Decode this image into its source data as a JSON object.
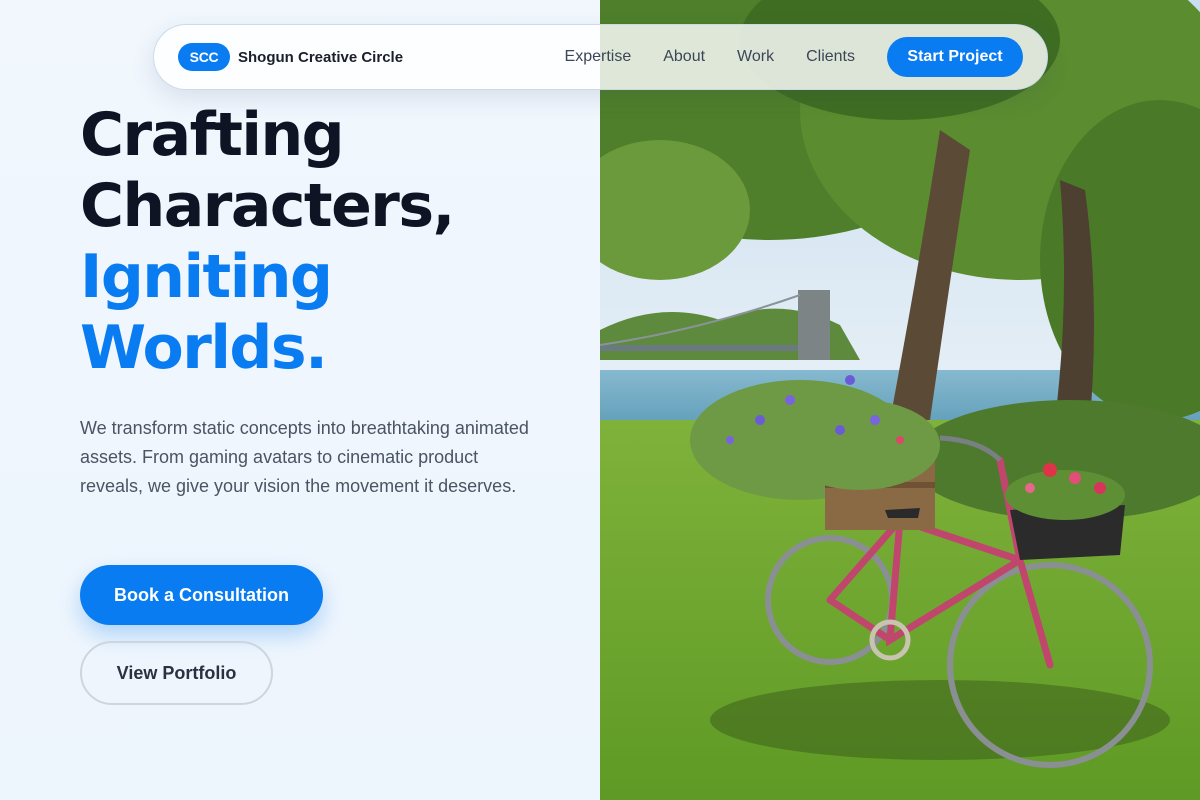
{
  "brand": {
    "badge": "SCC",
    "name": "Shogun Creative Circle"
  },
  "nav": {
    "links": [
      "Expertise",
      "About",
      "Work",
      "Clients"
    ],
    "cta": "Start Project"
  },
  "hero": {
    "line1": "Crafting",
    "line2": "Characters,",
    "line3": "Igniting",
    "line4": "Worlds.",
    "description": "We transform static concepts into breathtaking animated assets. From gaming avatars to cinematic product reveals, we give your vision the movement it deserves.",
    "primary_button": "Book a Consultation",
    "secondary_button": "View Portfolio"
  },
  "colors": {
    "accent": "#0a7cf2",
    "heading_dark": "#0f1424",
    "body_text": "#4a5462"
  },
  "image": {
    "subject": "pink bicycle with flower baskets in grass by a river and suspension bridge under trees"
  }
}
